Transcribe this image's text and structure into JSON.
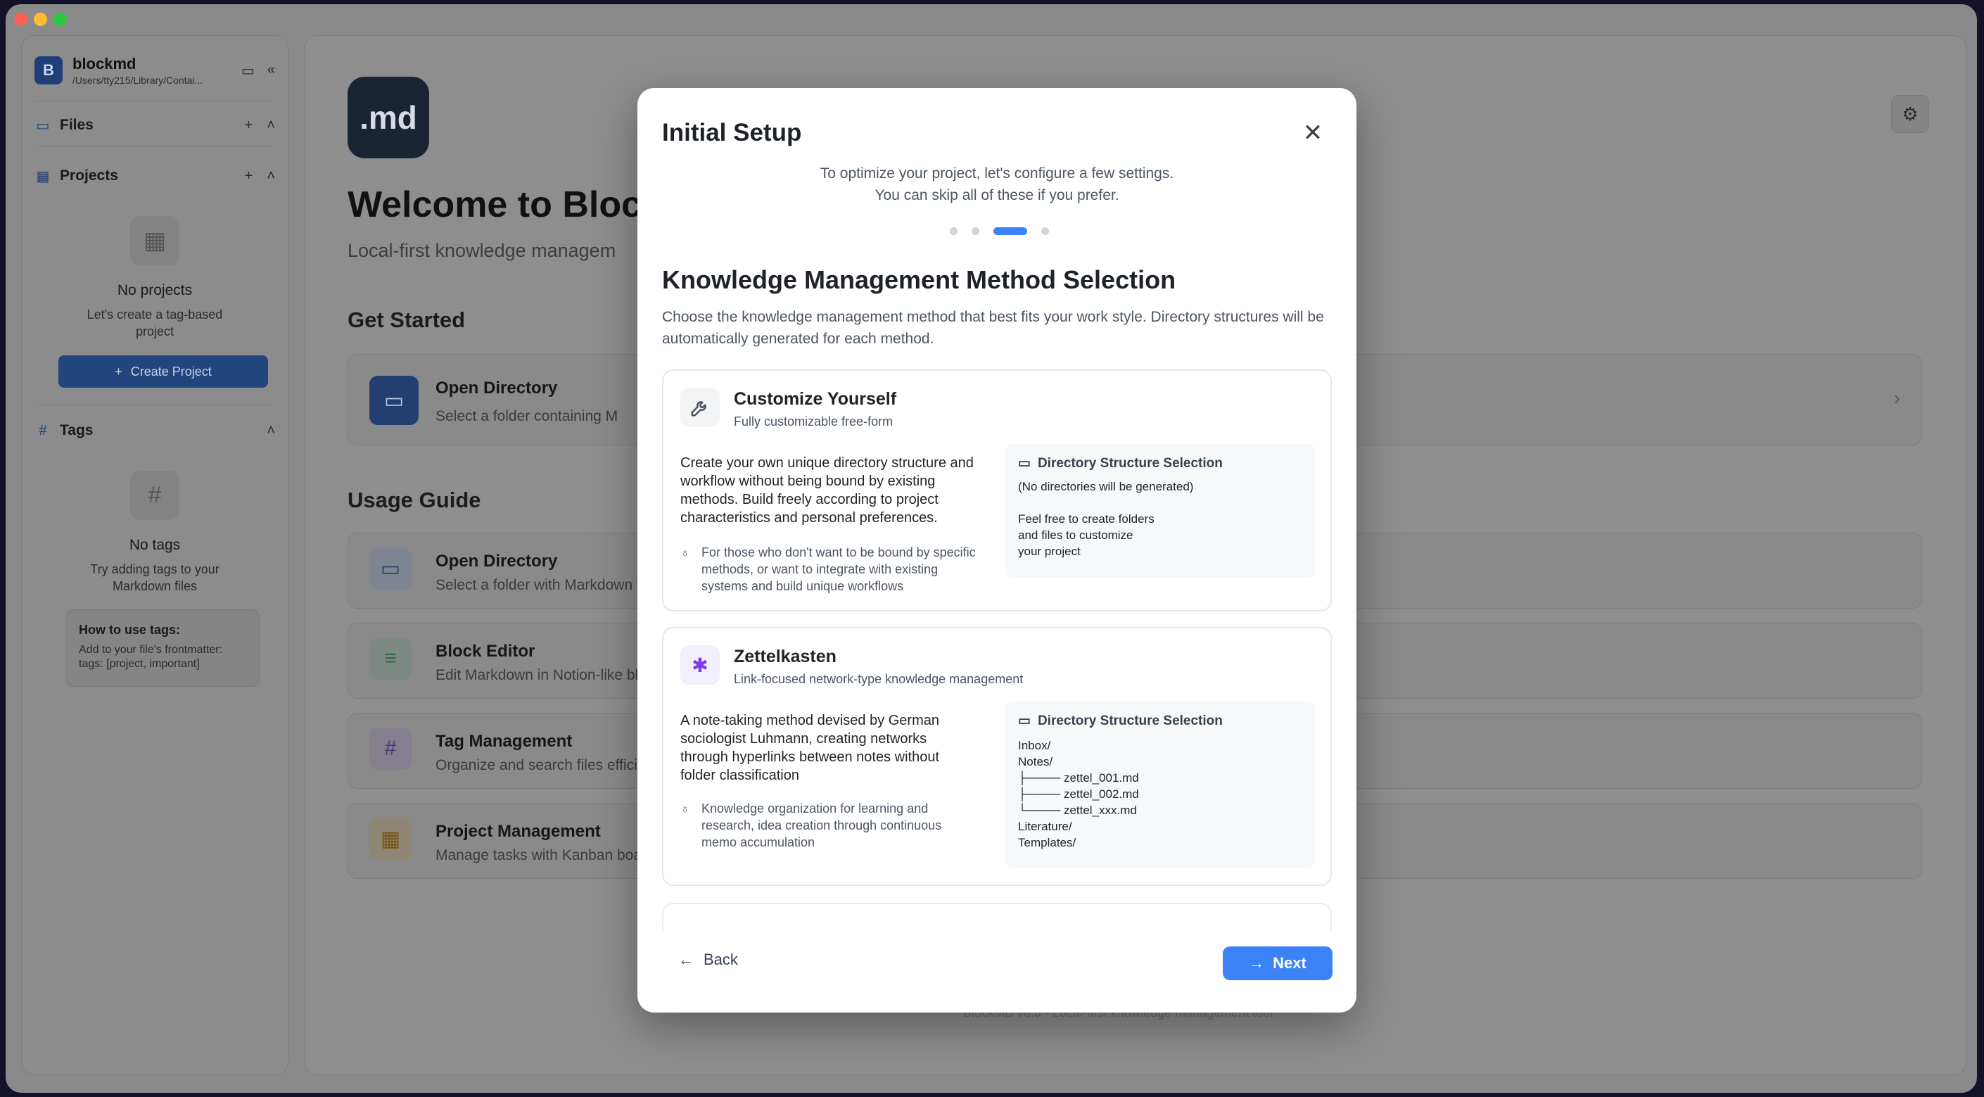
{
  "sidebar": {
    "logo_letter": "B",
    "app_name": "blockmd",
    "path": "/Users/tty215/Library/Contai...",
    "files_label": "Files",
    "projects_label": "Projects",
    "no_projects_title": "No projects",
    "no_projects_desc_1": "Let's create a tag-based",
    "no_projects_desc_2": "project",
    "create_project_label": "Create Project",
    "tags_label": "Tags",
    "no_tags_title": "No tags",
    "no_tags_desc_1": "Try adding tags to your",
    "no_tags_desc_2": "Markdown files",
    "howto_title": "How to use tags:",
    "howto_line1": "Add to your file's frontmatter:",
    "howto_line2": "tags: [project, important]"
  },
  "main": {
    "logo_text": ".md",
    "welcome": "Welcome to Block",
    "tagline": "Local-first knowledge managem",
    "get_started": "Get Started",
    "open_directory_title": "Open Directory",
    "open_directory_desc": "Select a folder containing M",
    "usage_guide": "Usage Guide",
    "guide": [
      {
        "title": "Open Directory",
        "desc": "Select a folder with Markdown fi"
      },
      {
        "title": "Block Editor",
        "desc": "Edit Markdown in Notion-like blo"
      },
      {
        "title": "Tag Management",
        "desc": "Organize and search files efficie"
      },
      {
        "title": "Project Management",
        "desc": "Manage tasks with Kanban boar"
      }
    ],
    "footer": "BlockMD v0.0 - Local-first knowledge management tool"
  },
  "modal": {
    "title": "Initial Setup",
    "subtitle_1": "To optimize your project, let's configure a few settings.",
    "subtitle_2": "You can skip all of these if you prefer.",
    "step_current": 3,
    "step_total": 4,
    "heading": "Knowledge Management Method Selection",
    "description": "Choose the knowledge management method that best fits your work style. Directory structures will be automatically generated for each method.",
    "methods": [
      {
        "title": "Customize Yourself",
        "subtitle": "Fully customizable free-form",
        "body": "Create your own unique directory structure and workflow without being bound by existing methods. Build freely according to project characteristics and personal preferences.",
        "note": "For those who don't want to be bound by specific methods, or want to integrate with existing systems and build unique workflows",
        "dir_title": "Directory Structure Selection",
        "dir_lines": [
          "(No directories will be generated)",
          "",
          "Feel free to create folders",
          "and files to customize",
          "your project"
        ]
      },
      {
        "title": "Zettelkasten",
        "subtitle": "Link-focused network-type knowledge management",
        "body": "A note-taking method devised by German sociologist Luhmann, creating networks through hyperlinks between notes without folder classification",
        "note": "Knowledge organization for learning and research, idea creation through continuous memo accumulation",
        "dir_title": "Directory Structure Selection",
        "dir_lines": [
          "Inbox/",
          "Notes/",
          "├──── zettel_001.md",
          "├──── zettel_002.md",
          "└──── zettel_xxx.md",
          "Literature/",
          "Templates/"
        ]
      }
    ],
    "back_label": "Back",
    "next_label": "Next"
  }
}
